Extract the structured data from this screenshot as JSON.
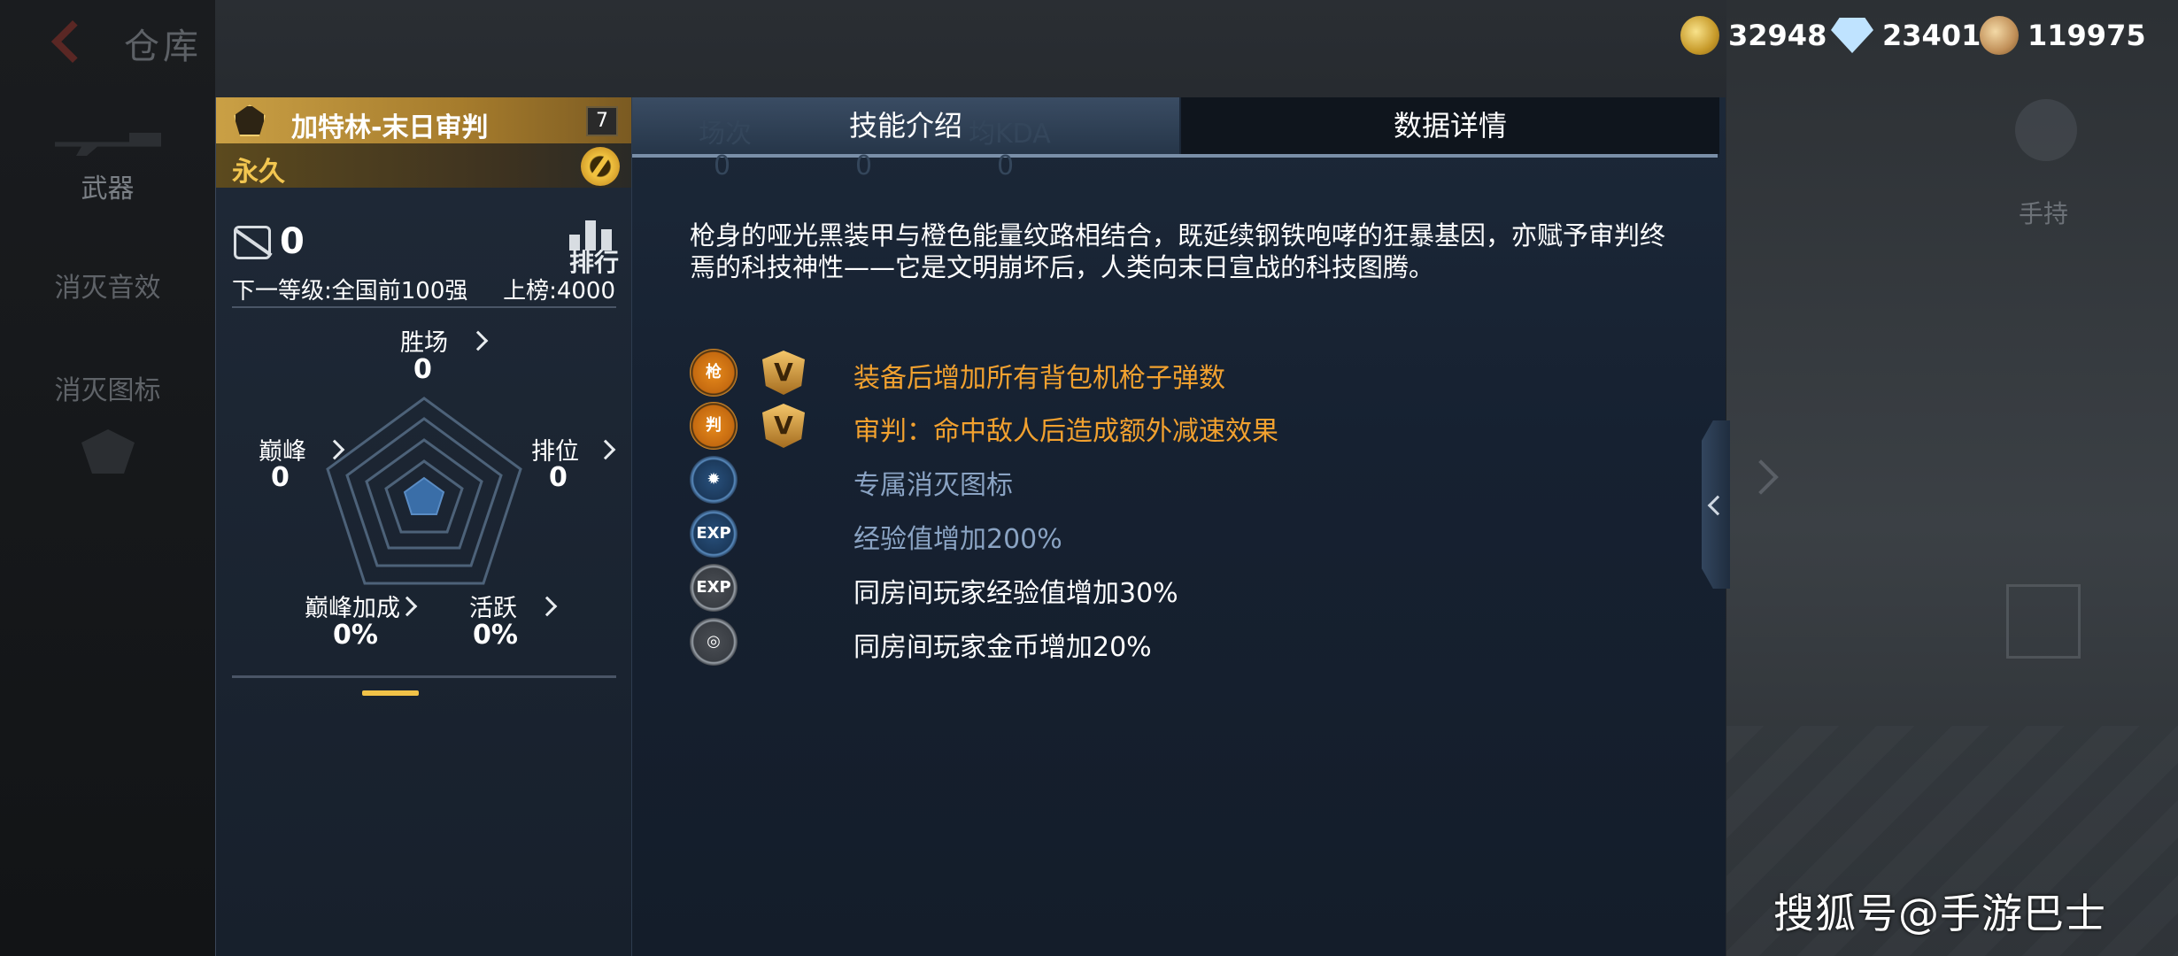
{
  "header": {
    "title": "仓库",
    "currencies": [
      {
        "icon": "gold-coin-icon",
        "value": "32948"
      },
      {
        "icon": "diamond-icon",
        "value": "23401"
      },
      {
        "icon": "bronze-coin-icon",
        "value": "119975"
      }
    ]
  },
  "sidebar": {
    "items": [
      {
        "label": "武器"
      },
      {
        "label": "消灭音效"
      },
      {
        "label": "消灭图标"
      }
    ]
  },
  "weapon_card": {
    "name": "加特林-末日审判",
    "level": "7",
    "duration": "永久",
    "kills": "0",
    "rank_label": "排行",
    "next_level": "下一等级:全国前100强",
    "on_board": "上榜:4000",
    "stats": {
      "wins": {
        "label": "胜场",
        "value": "0"
      },
      "peak": {
        "label": "巅峰",
        "value": "0"
      },
      "ranked": {
        "label": "排位",
        "value": "0"
      },
      "peak_bonus": {
        "label": "巅峰加成",
        "value": "0%"
      },
      "activity": {
        "label": "活跃",
        "value": "0%"
      }
    }
  },
  "panel": {
    "tabs": [
      {
        "label": "技能介绍",
        "active": true
      },
      {
        "label": "数据详情",
        "active": false
      }
    ],
    "ghost_text": {
      "matches": "场次",
      "kda": "均KDA",
      "zero": "0"
    },
    "description": "枪身的哑光黑装甲与橙色能量纹路相结合，既延续钢铁咆哮的狂暴基因，亦赋予审判终焉的科技神性——它是文明崩坏后，人类向末日宣战的科技图腾。",
    "skills": [
      {
        "icon": "machine-gun-icon",
        "style": "orange",
        "vip": "V",
        "text": "装备后增加所有背包机枪子弹数",
        "color": "orange"
      },
      {
        "icon": "judgement-icon",
        "style": "orange",
        "vip": "V",
        "text": "审判：命中敌人后造成额外减速效果",
        "color": "orange"
      },
      {
        "icon": "kill-icon-emblem",
        "style": "blue",
        "vip": "",
        "text": "专属消灭图标",
        "color": "blue"
      },
      {
        "icon": "exp-icon",
        "style": "blue",
        "vip": "",
        "text": "经验值增加200%",
        "color": "blue"
      },
      {
        "icon": "room-exp-icon",
        "style": "grey",
        "vip": "",
        "text": "同房间玩家经验值增加30%",
        "color": "white"
      },
      {
        "icon": "room-coin-icon",
        "style": "grey",
        "vip": "",
        "text": "同房间玩家金币增加20%",
        "color": "white"
      }
    ],
    "skill_glyphs": [
      "枪",
      "判",
      "✹",
      "EXP",
      "EXP",
      "◎"
    ]
  },
  "right": {
    "hold_label": "手持"
  },
  "watermark": "搜狐号@手游巴士"
}
